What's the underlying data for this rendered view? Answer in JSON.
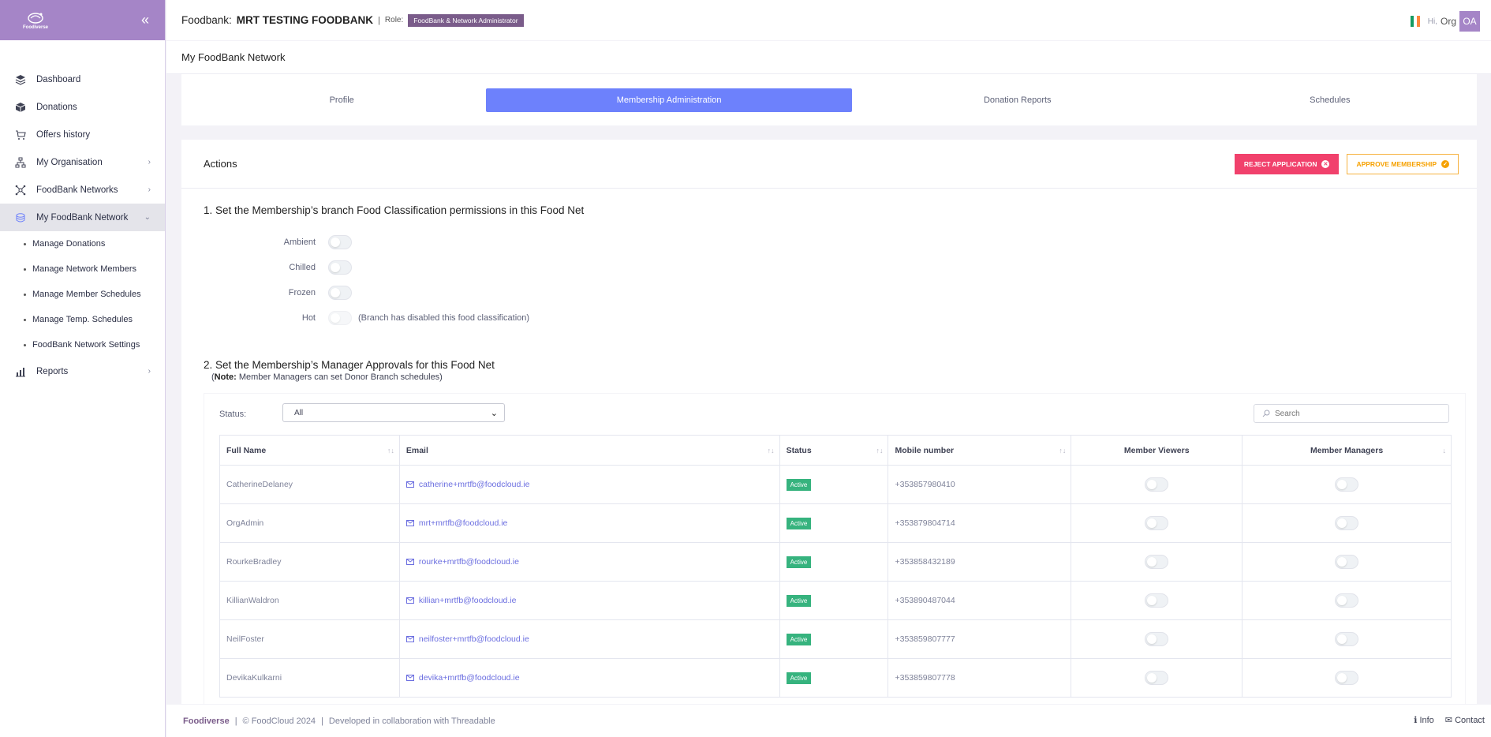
{
  "brand": {
    "logo_text": "Foodiverse",
    "collapse_icon": "double-chevron-left-icon"
  },
  "sidebar": {
    "items": [
      {
        "label": "Dashboard",
        "icon": "layers-icon"
      },
      {
        "label": "Donations",
        "icon": "box-icon"
      },
      {
        "label": "Offers history",
        "icon": "cart-history-icon"
      },
      {
        "label": "My Organisation",
        "icon": "org-chart-icon"
      },
      {
        "label": "FoodBank Networks",
        "icon": "network-icon"
      },
      {
        "label": "My FoodBank Network",
        "icon": "stack-icon"
      },
      {
        "label": "Reports",
        "icon": "bar-chart-icon"
      }
    ],
    "subitems": [
      "Manage Donations",
      "Manage Network Members",
      "Manage Member Schedules",
      "Manage Temp. Schedules",
      "FoodBank Network Settings"
    ]
  },
  "topbar": {
    "label": "Foodbank:",
    "name": "MRT TESTING FOODBANK",
    "separator": "|",
    "role_label": "Role:",
    "role": "FoodBank & Network Administrator",
    "greeting": "Hi,",
    "user": "Org",
    "avatar": "OA",
    "flag_colors": [
      "#169b62",
      "#ffffff",
      "#ff883e"
    ]
  },
  "page_title": "My FoodBank Network",
  "tabs": [
    "Profile",
    "Membership Administration",
    "Donation Reports",
    "Schedules"
  ],
  "actions": {
    "title": "Actions",
    "reject_label": "REJECT APPLICATION",
    "approve_label": "APPROVE MEMBERSHIP"
  },
  "section1": {
    "title": "1. Set the Membership’s branch Food Classification permissions in this Food Net",
    "permissions": [
      {
        "label": "Ambient",
        "note": ""
      },
      {
        "label": "Chilled",
        "note": ""
      },
      {
        "label": "Frozen",
        "note": ""
      },
      {
        "label": "Hot",
        "note": "(Branch has disabled this food classification)"
      }
    ]
  },
  "section2": {
    "title": "2. Set the Membership’s Manager Approvals for this Food Net",
    "note_bold": "Note:",
    "note_text": " Member Managers can set Donor Branch schedules)",
    "note_open": "("
  },
  "filters": {
    "status_label": "Status:",
    "status_value": "All",
    "search_placeholder": "Search"
  },
  "table": {
    "columns": [
      "Full Name",
      "Email",
      "Status",
      "Mobile number",
      "Member Viewers",
      "Member Managers"
    ],
    "rows": [
      {
        "name": "CatherineDelaney",
        "email": "catherine+mrtfb@foodcloud.ie",
        "status": "Active",
        "mobile": "+353857980410"
      },
      {
        "name": "OrgAdmin",
        "email": "mrt+mrtfb@foodcloud.ie",
        "status": "Active",
        "mobile": "+353879804714"
      },
      {
        "name": "RourkeBradley",
        "email": "rourke+mrtfb@foodcloud.ie",
        "status": "Active",
        "mobile": "+353858432189"
      },
      {
        "name": "KillianWaldron",
        "email": "killian+mrtfb@foodcloud.ie",
        "status": "Active",
        "mobile": "+353890487044"
      },
      {
        "name": "NeilFoster",
        "email": "neilfoster+mrtfb@foodcloud.ie",
        "status": "Active",
        "mobile": "+353859807777"
      },
      {
        "name": "DevikaKulkarni",
        "email": "devika+mrtfb@foodcloud.ie",
        "status": "Active",
        "mobile": "+353859807778"
      }
    ]
  },
  "footer": {
    "brand": "Foodiverse",
    "sep": "|",
    "copyright": "© FoodCloud 2024",
    "collab": "Developed in collaboration with Threadable",
    "info": "Info",
    "contact": "Contact"
  }
}
